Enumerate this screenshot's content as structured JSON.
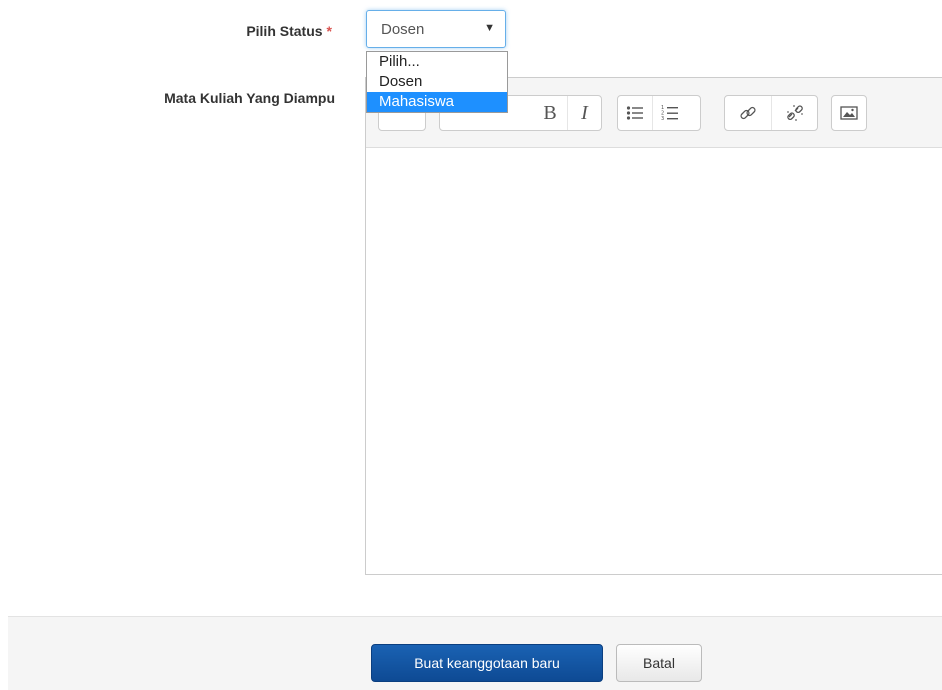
{
  "form": {
    "status_label": "Pilih Status",
    "required_mark": "*",
    "matkul_label": "Mata Kuliah Yang Diampu"
  },
  "status_select": {
    "value": "Dosen",
    "options": [
      {
        "label": "Pilih..."
      },
      {
        "label": "Dosen"
      },
      {
        "label": "Mahasiswa",
        "highlighted": true
      }
    ]
  },
  "editor": {
    "toolbar": {
      "bold_label": "B",
      "italic_label": "I",
      "icons": [
        "bullet-list-icon",
        "numbered-list-icon",
        "link-icon",
        "unlink-icon",
        "image-icon"
      ]
    }
  },
  "footer": {
    "submit_label": "Buat keanggotaan baru",
    "cancel_label": "Batal"
  },
  "colors": {
    "primary": "#0e4a94",
    "highlight": "#1e90ff",
    "required": "#d9534f"
  }
}
